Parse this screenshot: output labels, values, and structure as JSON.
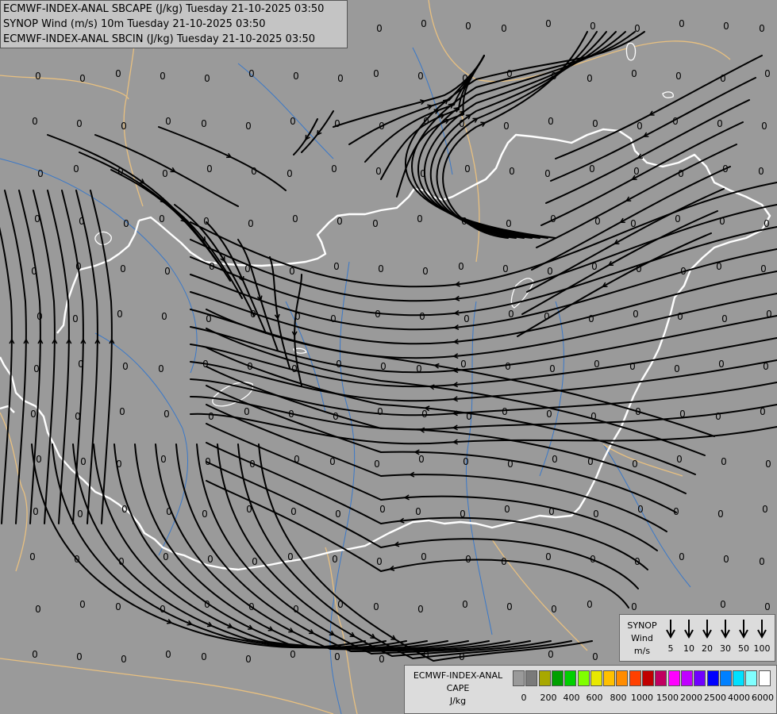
{
  "header": {
    "line1": "ECMWF-INDEX-ANAL SBCAPE (J/kg) Tuesday 21-10-2025 03:50",
    "line2": "SYNOP Wind (m/s) 10m Tuesday 21-10-2025 03:50",
    "line3": "ECMWF-INDEX-ANAL SBCIN (J/kg) Tuesday 21-10-2025 03:50"
  },
  "grid_value": "0",
  "synop_legend": {
    "title_lines": [
      "SYNOP",
      "Wind",
      "m/s"
    ],
    "speeds": [
      "5",
      "10",
      "20",
      "30",
      "50",
      "100"
    ]
  },
  "cape_legend": {
    "title_lines": [
      "ECMWF-INDEX-ANAL",
      "CAPE",
      "J/kg"
    ],
    "colors": [
      "#9a9a9a",
      "#7a7a7a",
      "#a8a800",
      "#00a000",
      "#00d000",
      "#80ff00",
      "#e8e800",
      "#ffc000",
      "#ff8c00",
      "#ff4000",
      "#c00000",
      "#c00060",
      "#ff00ff",
      "#c000ff",
      "#7000ff",
      "#0000ff",
      "#0080ff",
      "#00e0ff",
      "#80ffff",
      "#ffffff"
    ],
    "ticks": [
      "0",
      "200",
      "400",
      "600",
      "800",
      "1000",
      "1500",
      "2000",
      "2500",
      "4000",
      "6000"
    ]
  },
  "colors": {
    "background": "#9a9a9a",
    "border_national": "#ffffff",
    "border_neighbor": "#e8c080",
    "rivers": "#3a78c8",
    "streamlines": "#000000"
  }
}
